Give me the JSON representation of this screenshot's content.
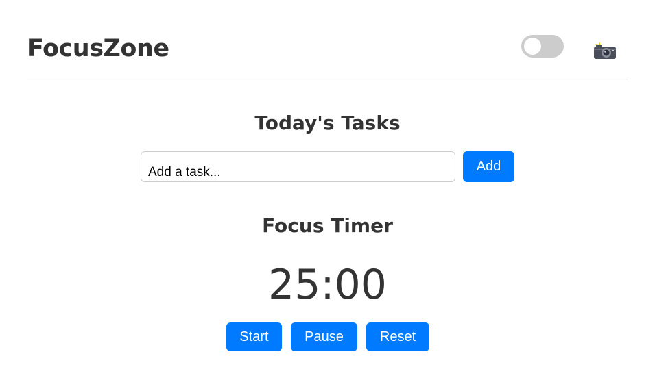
{
  "app": {
    "title": "FocusZone",
    "theme_toggle": {
      "on": false
    },
    "camera_icon": "camera-with-flash-icon"
  },
  "tasks": {
    "heading": "Today's Tasks",
    "input_placeholder": "Add a task...",
    "add_label": "Add"
  },
  "timer": {
    "heading": "Focus Timer",
    "display": "25:00",
    "start_label": "Start",
    "pause_label": "Pause",
    "reset_label": "Reset"
  },
  "colors": {
    "accent": "#007bff",
    "text": "#333333",
    "toggle_off": "#cccccc",
    "divider": "#cfcfcf"
  }
}
